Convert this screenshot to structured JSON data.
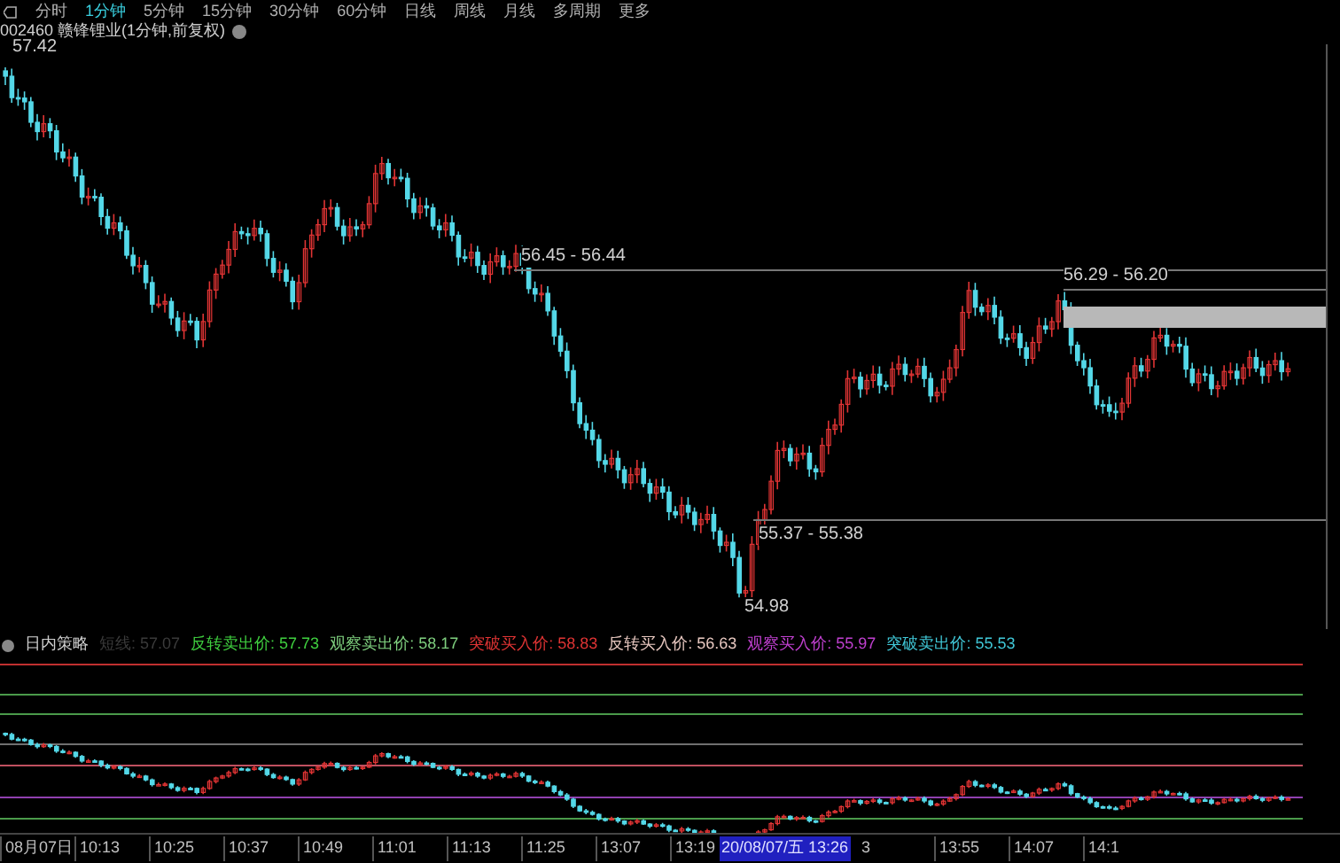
{
  "period_tabs": [
    {
      "label": "分时",
      "selected": false
    },
    {
      "label": "1分钟",
      "selected": true
    },
    {
      "label": "5分钟",
      "selected": false
    },
    {
      "label": "15分钟",
      "selected": false
    },
    {
      "label": "30分钟",
      "selected": false
    },
    {
      "label": "60分钟",
      "selected": false
    },
    {
      "label": "日线",
      "selected": false
    },
    {
      "label": "周线",
      "selected": false
    },
    {
      "label": "月线",
      "selected": false
    },
    {
      "label": "多周期",
      "selected": false
    },
    {
      "label": "更多",
      "selected": false
    }
  ],
  "symbol_title": "002460 赣锋锂业(1分钟,前复权)",
  "price_labels": [
    "57.42",
    "56.45 - 56.44",
    "56.29 - 56.20",
    "55.37 - 55.38",
    "54.98"
  ],
  "indicator": {
    "name": "日内策略",
    "faded_value": "短线: 57.07",
    "values": [
      {
        "label": "反转卖出价: 57.73",
        "color": "#3fcf3f"
      },
      {
        "label": "观察卖出价: 58.17",
        "color": "#7fd07f"
      },
      {
        "label": "突破买入价: 58.83",
        "color": "#e03434"
      },
      {
        "label": "反转买入价: 56.63",
        "color": "#e8c8c0"
      },
      {
        "label": "观察买入价: 55.97",
        "color": "#c040d0"
      },
      {
        "label": "突破卖出价: 55.53",
        "color": "#40c8d8"
      }
    ]
  },
  "time_axis": [
    "08月07日",
    "10:13",
    "10:25",
    "10:37",
    "10:49",
    "11:01",
    "11:13",
    "11:25",
    "13:07",
    "13:19",
    "3",
    "13:55",
    "14:07",
    "14:1"
  ],
  "cursor_time": "20/08/07/五 13:26"
}
